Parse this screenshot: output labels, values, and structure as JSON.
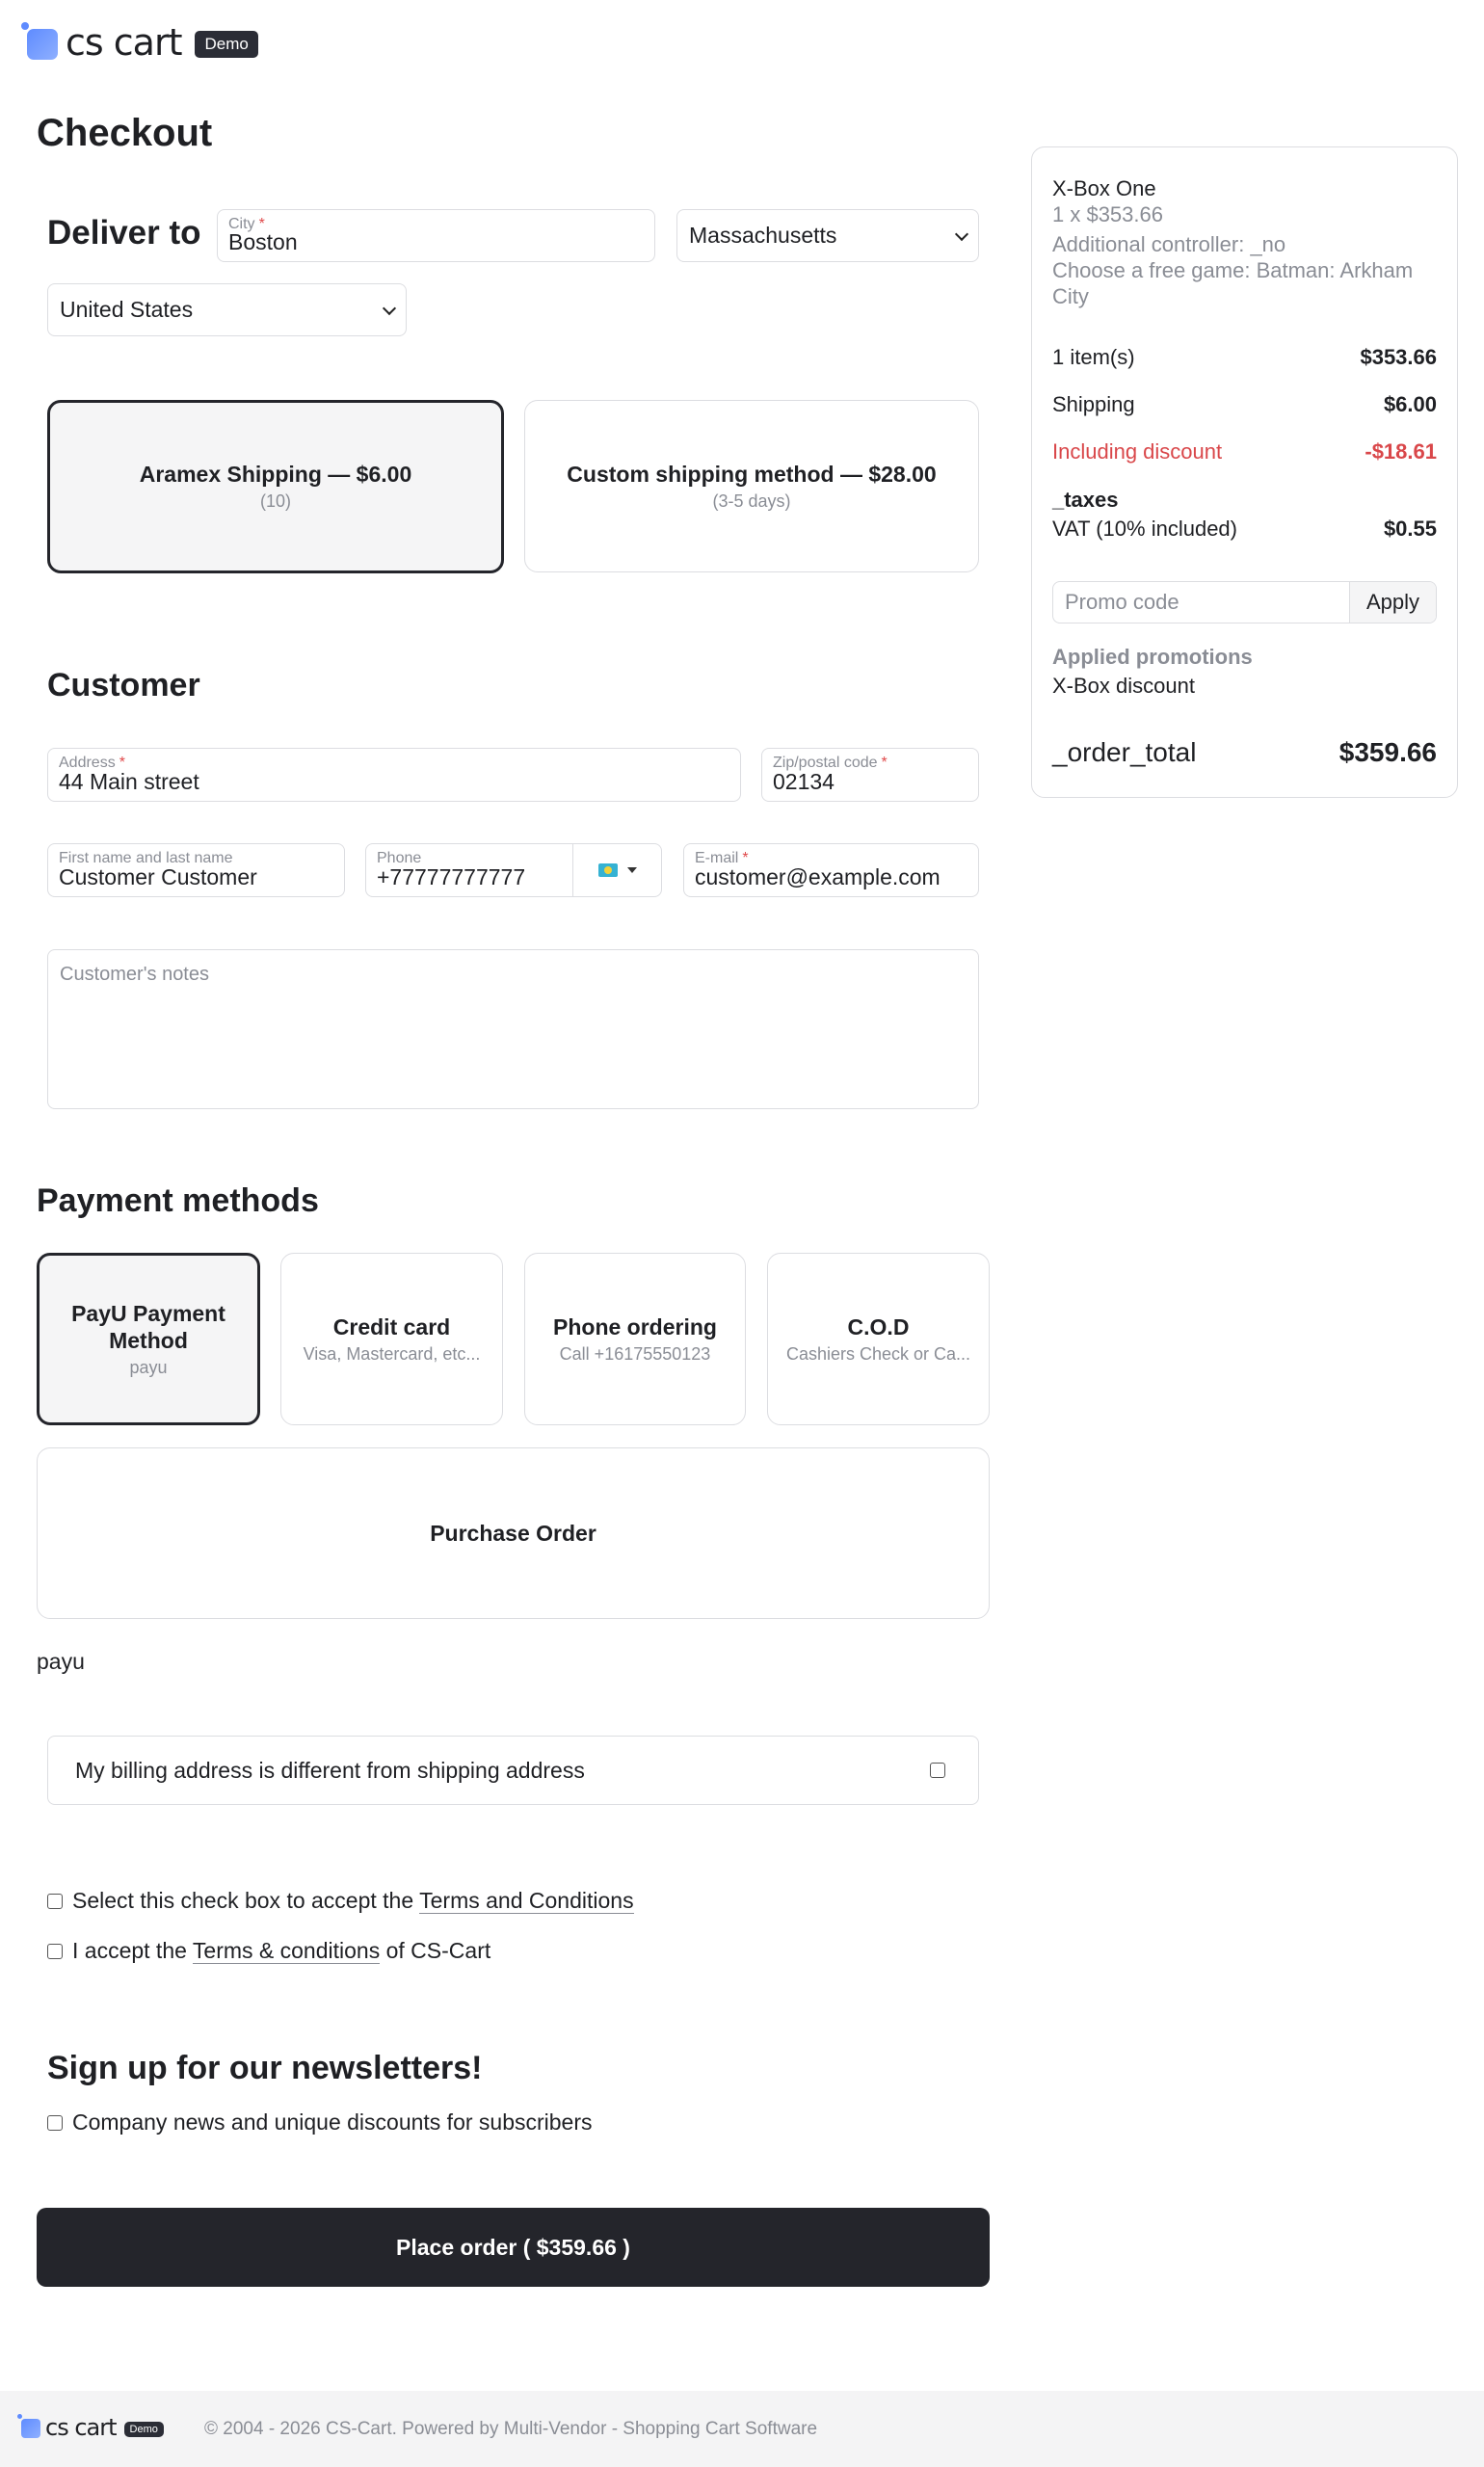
{
  "header": {
    "logo_text": "cs cart",
    "demo_badge": "Demo"
  },
  "page_title": "Checkout",
  "delivery": {
    "label": "Deliver to",
    "city_label": "City",
    "city_value": "Boston",
    "state_value": "Massachusetts",
    "country_value": "United States"
  },
  "shipping_methods": [
    {
      "title": "Aramex Shipping — $6.00",
      "subtitle": "(10)"
    },
    {
      "title": "Custom shipping method — $28.00",
      "subtitle": "(3-5 days)"
    }
  ],
  "customer": {
    "heading": "Customer",
    "address_label": "Address",
    "address_value": "44 Main street",
    "zip_label": "Zip/postal code",
    "zip_value": "02134",
    "name_label": "First name and last name",
    "name_value": "Customer Customer",
    "phone_label": "Phone",
    "phone_value": "+77777777777",
    "email_label": "E-mail",
    "email_value": "customer@example.com",
    "notes_placeholder": "Customer's notes"
  },
  "payment": {
    "heading": "Payment methods",
    "methods": [
      {
        "title": "PayU Payment Method",
        "subtitle": "payu"
      },
      {
        "title": "Credit card",
        "subtitle": "Visa, Mastercard, etc..."
      },
      {
        "title": "Phone ordering",
        "subtitle": "Call +16175550123"
      },
      {
        "title": "C.O.D",
        "subtitle": "Cashiers Check or Ca..."
      },
      {
        "title": "Purchase Order",
        "subtitle": ""
      }
    ],
    "selected_description": "payu"
  },
  "billing_different_label": "My billing address is different from shipping address",
  "terms": {
    "row1_prefix": "Select this check box to accept the",
    "row1_link": "Terms and Conditions",
    "row2_prefix": "I accept the",
    "row2_link": "Terms & conditions",
    "row2_suffix": "of CS-Cart"
  },
  "newsletter": {
    "heading": "Sign up for our newsletters!",
    "option": "Company news and unique discounts for subscribers"
  },
  "place_order_label": "Place order ( $359.66 )",
  "summary": {
    "product_name": "X-Box One",
    "product_qty_price": "1 x $353.66",
    "option1": "Additional controller: _no",
    "option2": "Choose a free game: Batman: Arkham City",
    "items_label": "1 item(s)",
    "items_value": "$353.66",
    "shipping_label": "Shipping",
    "shipping_value": "$6.00",
    "discount_label": "Including discount",
    "discount_value": "-$18.61",
    "taxes_heading": "_taxes",
    "vat_label": "VAT (10% included)",
    "vat_value": "$0.55",
    "promo_placeholder": "Promo code",
    "promo_apply": "Apply",
    "applied_heading": "Applied promotions",
    "applied_name": "X-Box discount",
    "total_label": "_order_total",
    "total_value": "$359.66"
  },
  "footer": {
    "logo_text": "cs cart",
    "demo_badge": "Demo",
    "copyright": "© 2004 - 2026 CS-Cart.  Powered by Multi-Vendor - Shopping Cart Software"
  },
  "colors": {
    "accent_dark": "#24252b",
    "discount_red": "#d9474a",
    "logo_blue": "#5e8bff"
  }
}
